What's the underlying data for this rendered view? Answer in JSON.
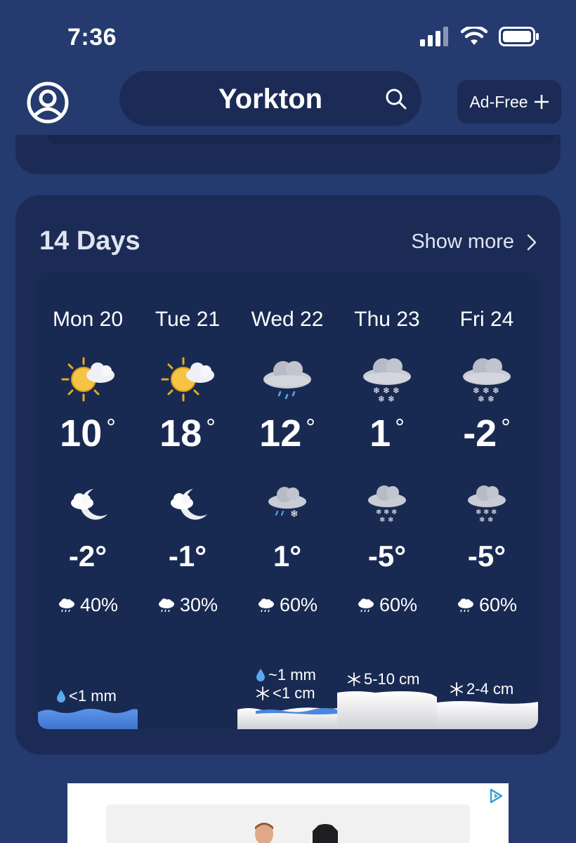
{
  "status_bar": {
    "time": "7:36",
    "icons": [
      "signal-icon",
      "wifi-icon",
      "battery-icon"
    ]
  },
  "header": {
    "profile_icon": "profile-icon",
    "city": "Yorkton",
    "search_icon": "search-icon",
    "ad_free_label": "Ad-Free",
    "ad_free_icon": "plus-icon"
  },
  "forecast_card": {
    "title": "14 Days",
    "show_more": "Show more",
    "days": [
      {
        "label": "Mon 20",
        "day_icon": "sun-cloud-icon",
        "high": "10",
        "night_icon": "moon-cloud-icon",
        "low": "-2°",
        "precip": "40%",
        "amount_rain": "<1 mm",
        "amount_snow": ""
      },
      {
        "label": "Tue 21",
        "day_icon": "sun-cloud-icon",
        "high": "18",
        "night_icon": "moon-cloud-icon",
        "low": "-1°",
        "precip": "30%",
        "amount_rain": "",
        "amount_snow": ""
      },
      {
        "label": "Wed 22",
        "day_icon": "rain-cloud-icon",
        "high": "12",
        "night_icon": "sleet-cloud-icon",
        "low": "1°",
        "precip": "60%",
        "amount_rain": "~1 mm",
        "amount_snow": "<1 cm"
      },
      {
        "label": "Thu 23",
        "day_icon": "snow-cloud-icon",
        "high": "1",
        "night_icon": "snow-cloud-icon",
        "low": "-5°",
        "precip": "60%",
        "amount_rain": "",
        "amount_snow": "5-10 cm"
      },
      {
        "label": "Fri 24",
        "day_icon": "snow-cloud-icon",
        "high": "-2",
        "night_icon": "snow-cloud-icon",
        "low": "-5°",
        "precip": "60%",
        "amount_rain": "",
        "amount_snow": "2-4 cm"
      }
    ]
  },
  "colors": {
    "background": "#253a6e",
    "card": "#1b2b55",
    "panel": "#192a52",
    "rain": "#4a86e0",
    "snow": "#e8e9ee"
  },
  "ad": {
    "icon": "ad-choices-icon"
  }
}
